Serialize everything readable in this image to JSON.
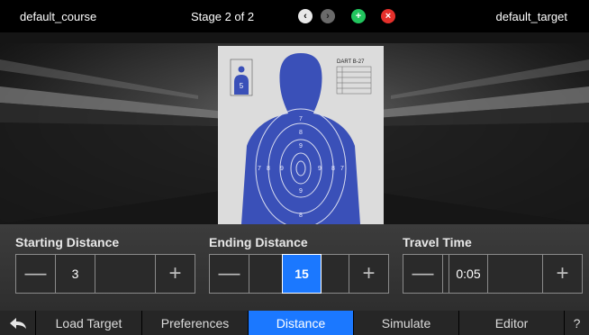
{
  "topbar": {
    "course": "default_course",
    "stage": "Stage 2 of 2",
    "target": "default_target",
    "icons": {
      "prev": "chevron-left-icon",
      "next": "chevron-right-icon",
      "add": "plus-icon",
      "remove": "close-icon"
    },
    "colors": {
      "add": "#22c55e",
      "remove": "#e5302b"
    }
  },
  "target": {
    "title": "DART B-27",
    "inset_number": "5",
    "rings": {
      "top_7": "7",
      "top_8": "8",
      "top_9": "9",
      "left_7": "7",
      "left_8": "8",
      "left_9": "9",
      "right_9": "9",
      "right_8": "8",
      "right_7": "7",
      "bottom_9": "9",
      "bottom_8": "8"
    }
  },
  "controls": {
    "starting": {
      "label": "Starting Distance",
      "value": "3"
    },
    "ending": {
      "label": "Ending Distance",
      "value": "15"
    },
    "travel": {
      "label": "Travel Time",
      "value": "0:05"
    },
    "minus_glyph": "—",
    "plus_glyph": "+",
    "accent": "#1b78ff"
  },
  "tabs": {
    "back_icon": "back-arrow-icon",
    "items": [
      "Load Target",
      "Preferences",
      "Distance",
      "Simulate",
      "Editor"
    ],
    "help": "?",
    "active": "Distance"
  }
}
